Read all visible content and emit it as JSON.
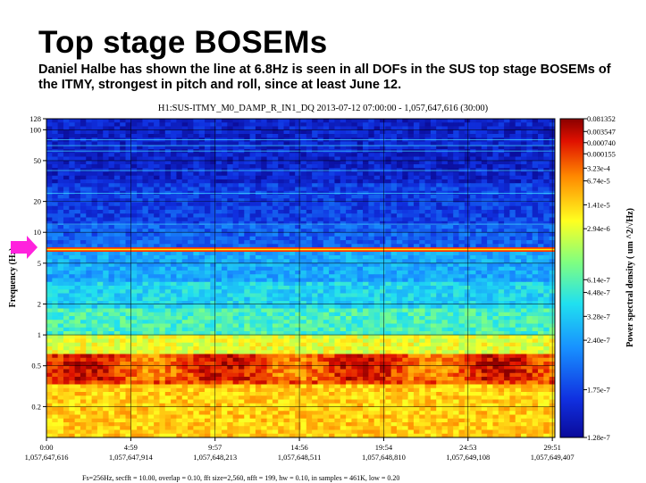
{
  "slide": {
    "title": "Top stage BOSEMs",
    "subtitle": "Daniel Halbe has shown the line at 6.8Hz is seen in all DOFs in the SUS top stage BOSEMs of the ITMY, strongest in pitch and roll, since at least June 12."
  },
  "chart_data": {
    "type": "heatmap",
    "title": "H1:SUS-ITMY_M0_DAMP_R_IN1_DQ 2013-07-12 07:00:00 - 1,057,647,616 (30:00)",
    "ylabel": "Frequency (Hz)",
    "colorbar_label": "Power spectral density (   um   ^2/√Hz)",
    "y_scale": "log",
    "ylim": [
      0.1,
      128
    ],
    "y_ticks": [
      {
        "value": 128,
        "label": "128"
      },
      {
        "value": 100,
        "label": "100"
      },
      {
        "value": 50,
        "label": "50"
      },
      {
        "value": 20,
        "label": "20"
      },
      {
        "value": 10,
        "label": "10"
      },
      {
        "value": 5,
        "label": "5"
      },
      {
        "value": 2,
        "label": "2"
      },
      {
        "value": 1,
        "label": "1"
      },
      {
        "value": 0.5,
        "label": "0.5"
      },
      {
        "value": 0.2,
        "label": "0.2"
      }
    ],
    "x_ticks": [
      {
        "label": "0:00",
        "gps": "1,057,647,616"
      },
      {
        "label": "4:59",
        "gps": "1,057,647,914"
      },
      {
        "label": "9:57",
        "gps": "1,057,648,213"
      },
      {
        "label": "14:56",
        "gps": "1,057,648,511"
      },
      {
        "label": "19:54",
        "gps": "1,057,648,810"
      },
      {
        "label": "24:53",
        "gps": "1,057,649,108"
      },
      {
        "label": "29:51",
        "gps": "1,057,649,407"
      }
    ],
    "colorbar_ticks": [
      "0.081352",
      "0.003547",
      "0.000740",
      "0.000155",
      "3.23e-4",
      "6.74e-5",
      "1.41e-5",
      "2.94e-6",
      "6.14e-7",
      "4.48e-7",
      "3.28e-7",
      "2.40e-7",
      "1.75e-7",
      "1.28e-7"
    ],
    "highlight_line_hz": 6.8,
    "grid": true,
    "arrow_color": "#ff22dd",
    "footer": "Fs=256Hz, secfft = 10.00, overlap = 0.10, fft size=2,560, nfft = 199, hw = 0.10, in samples = 461K, low = 0.20"
  }
}
